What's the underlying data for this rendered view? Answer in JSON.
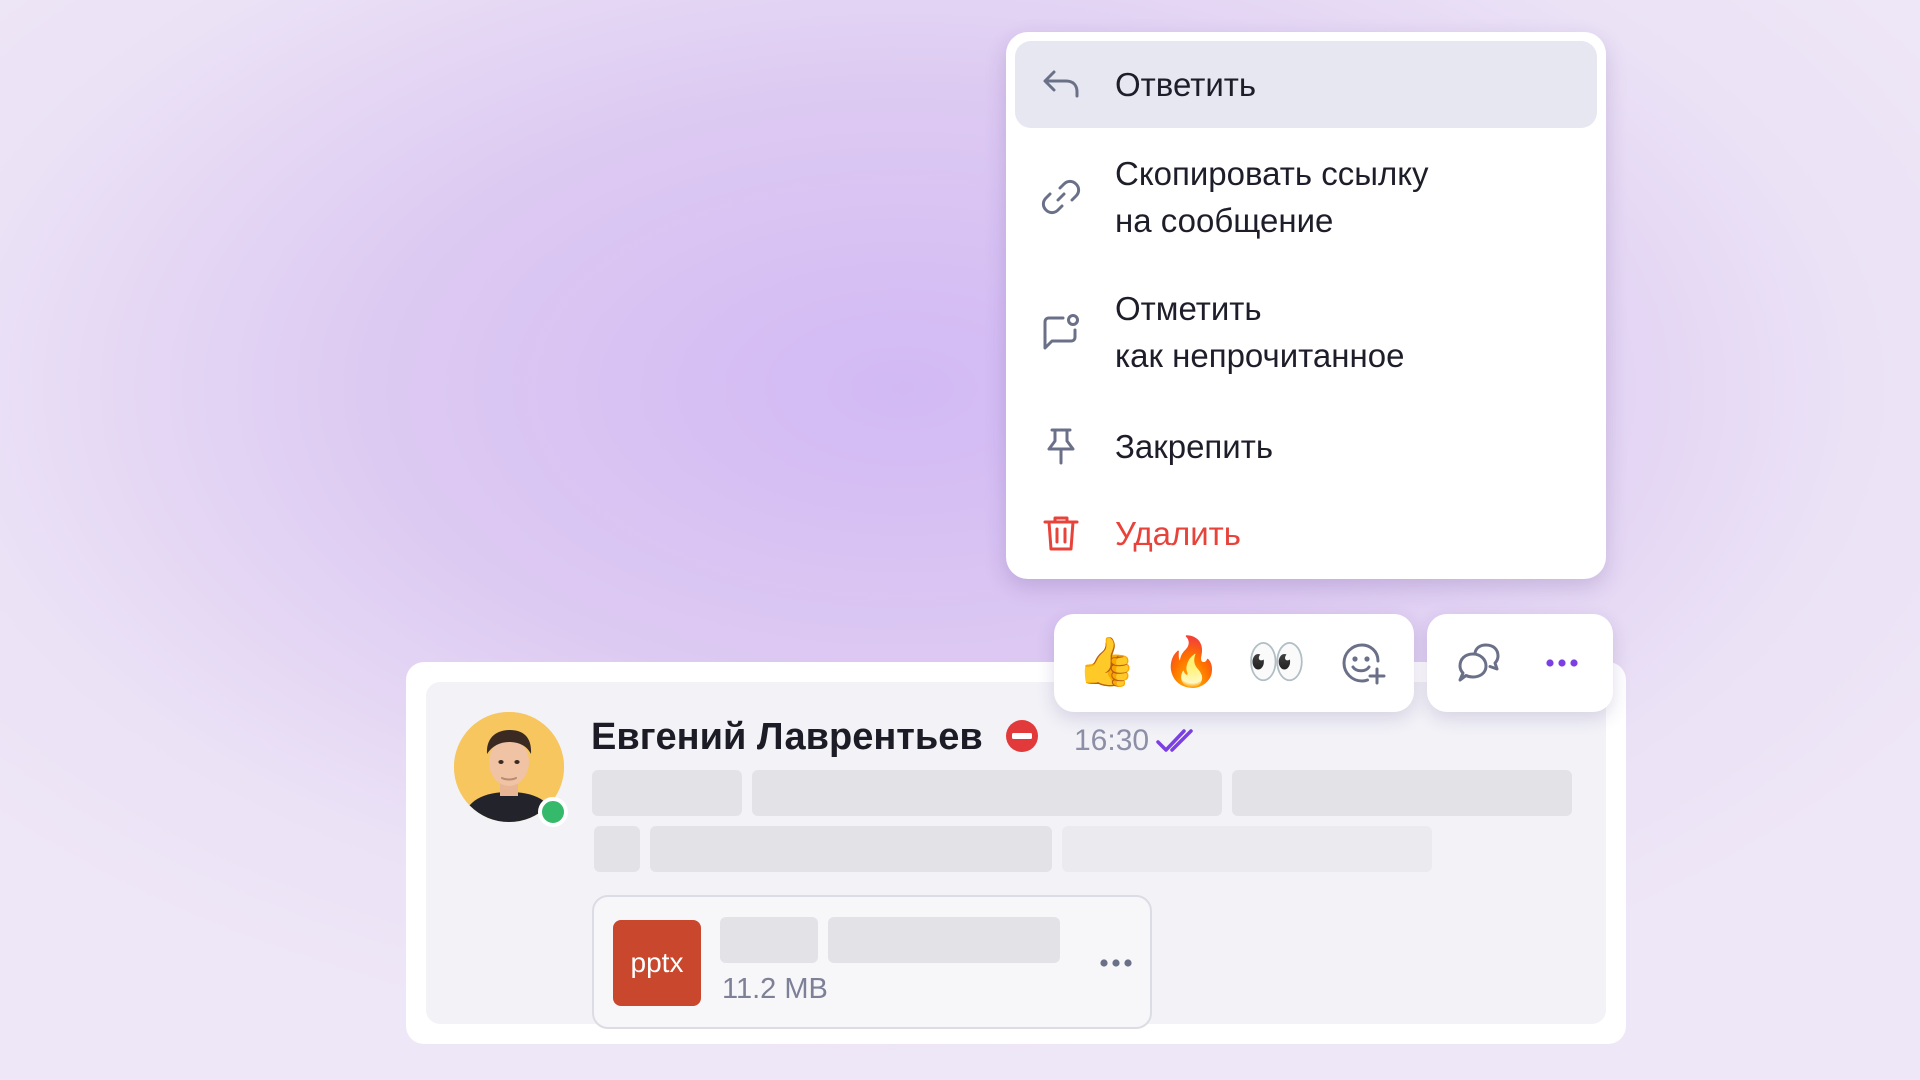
{
  "menu": {
    "items": [
      {
        "label": "Ответить",
        "icon": "reply-icon",
        "active": true
      },
      {
        "label": "Скопировать ссылку\nна сообщение",
        "icon": "link-icon"
      },
      {
        "label": "Отметить\nкак непрочитанное",
        "icon": "mark-unread-icon"
      },
      {
        "label": "Закрепить",
        "icon": "pin-icon"
      },
      {
        "label": "Удалить",
        "icon": "trash-icon",
        "danger": true
      }
    ]
  },
  "reactions": [
    {
      "emoji": "👍",
      "name": "thumbs-up"
    },
    {
      "emoji": "🔥",
      "name": "fire"
    },
    {
      "emoji": "👀",
      "name": "eyes"
    }
  ],
  "message": {
    "author": "Евгений Лаврентьев",
    "time": "16:30",
    "author_online": true,
    "attachment": {
      "type_label": "pptx",
      "size": "11.2 MB"
    }
  },
  "colors": {
    "accent": "#7b3fe4",
    "danger": "#e8433b",
    "online": "#35b96b",
    "pptx": "#c9472d",
    "icon_gray": "#6b7089"
  }
}
